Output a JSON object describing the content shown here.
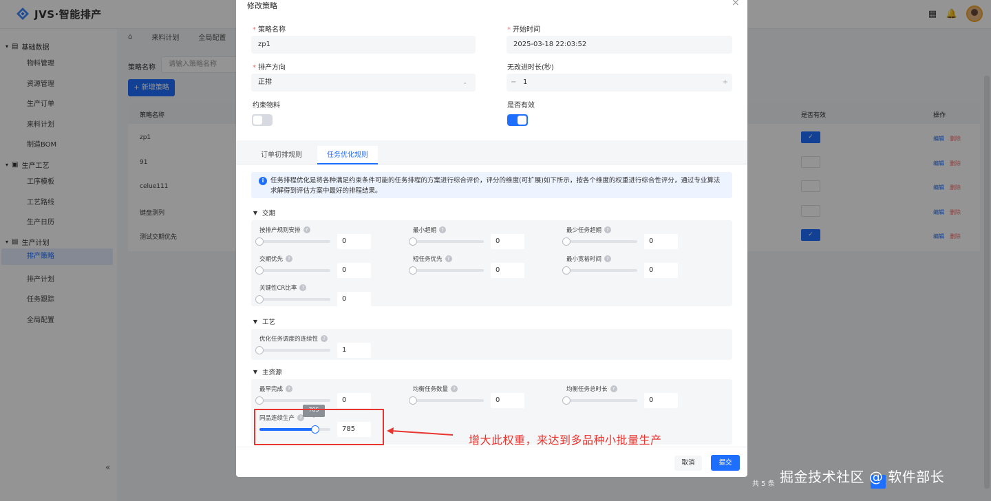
{
  "app": {
    "brand": "JVS·智能排产"
  },
  "sidebar": {
    "groups": [
      {
        "label": "基础数据",
        "items": [
          "物料管理",
          "资源管理",
          "生产订单",
          "来料计划",
          "制造BOM"
        ]
      },
      {
        "label": "生产工艺",
        "items": [
          "工序模板",
          "工艺路线",
          "生产日历"
        ]
      },
      {
        "label": "生产计划",
        "items": [
          "排产策略",
          "排产计划",
          "任务跟踪",
          "全局配置"
        ]
      }
    ],
    "active_item": "排产策略",
    "collapse_glyph": "«"
  },
  "page": {
    "tabs": [
      "来料计划",
      "全局配置"
    ],
    "filter_label": "策略名称",
    "filter_placeholder": "请输入策略名称",
    "add_button": "+ 新增策略",
    "table": {
      "headers": {
        "name": "策略名称",
        "valid": "是否有效",
        "ops": "操作"
      },
      "rows": [
        {
          "name": "zp1",
          "valid": true
        },
        {
          "name": "91",
          "valid": false
        },
        {
          "name": "celue111",
          "valid": false
        },
        {
          "name": "键盘测列",
          "valid": false
        },
        {
          "name": "测试交期优先",
          "valid": true
        }
      ],
      "edit_label": "编辑",
      "delete_label": "删除"
    },
    "total_text": "共 5 条"
  },
  "modal": {
    "title": "修改策略",
    "close_glyph": "×",
    "fields": {
      "name_label": "策略名称",
      "name_value": "zp1",
      "start_label": "开始时间",
      "start_value": "2025-03-18 22:03:52",
      "direction_label": "排产方向",
      "direction_value": "正排",
      "no_improve_label": "无改进时长(秒)",
      "no_improve_value": "1",
      "minus": "−",
      "plus": "+",
      "constraint_label": "约束物料",
      "constraint_on": false,
      "valid_label": "是否有效",
      "valid_on": true
    },
    "tabs": [
      "订单初排规则",
      "任务优化规则"
    ],
    "active_tab": "任务优化规则",
    "info_icon": "i",
    "info_text": "任务排程优化是将各种满足约束条件可能的任务排程的方案进行综合评价，评分的维度(可扩展)如下所示，按各个维度的权重进行综合性评分，通过专业算法求解得到评估方案中最好的排程结果。",
    "sections": [
      {
        "title": "交期",
        "rows": [
          [
            {
              "label": "按排产规则安排",
              "value": "0",
              "level": 0
            },
            {
              "label": "最小超期",
              "value": "0",
              "level": 0
            },
            {
              "label": "最少任务超期",
              "value": "0",
              "level": 0
            }
          ],
          [
            {
              "label": "交期优先",
              "value": "0",
              "level": 0
            },
            {
              "label": "短任务优先",
              "value": "0",
              "level": 0
            },
            {
              "label": "最小宽裕时间",
              "value": "0",
              "level": 0
            }
          ],
          [
            {
              "label": "关键性CR比率",
              "value": "0",
              "level": 0
            }
          ]
        ]
      },
      {
        "title": "工艺",
        "rows": [
          [
            {
              "label": "优化任务调度的连续性",
              "value": "1",
              "level": 0
            }
          ]
        ]
      },
      {
        "title": "主资源",
        "rows": [
          [
            {
              "label": "最早完成",
              "value": "0",
              "level": 0
            },
            {
              "label": "均衡任务数量",
              "value": "0",
              "level": 0
            },
            {
              "label": "均衡任务总时长",
              "value": "0",
              "level": 0
            }
          ],
          [
            {
              "label": "同品连续生产",
              "value": "785",
              "level": 0.785,
              "tooltip": "785"
            }
          ]
        ]
      }
    ],
    "cancel": "取消",
    "submit": "提交"
  },
  "annotation": {
    "text": "增大此权重，来达到多品种小批量生产",
    "color": "#e8352f"
  },
  "watermark": "掘金技术社区 @ 软件部长",
  "colors": {
    "primary": "#1e6fff",
    "danger": "#f56c6c"
  }
}
